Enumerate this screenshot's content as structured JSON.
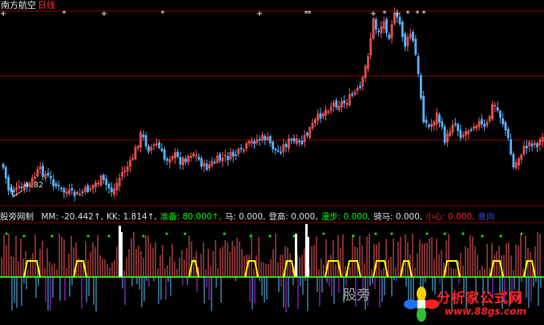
{
  "header": {
    "stock_name": "南方航空",
    "period": "日线"
  },
  "price_chart": {
    "low_label": "4.82",
    "colors": {
      "up": "#ff5a5a",
      "down": "#5ab4ff",
      "grid": "#8b0000",
      "marker": "#ffffff"
    }
  },
  "indicator": {
    "name": "股旁网制",
    "fields": [
      {
        "text": "MM: -20.442↑,",
        "color": "#e0e0e0"
      },
      {
        "text": "KK: 1.814↑,",
        "color": "#e0e0e0"
      },
      {
        "text": "准备: 80.000↑,",
        "color": "#00ff00"
      },
      {
        "text": "马: 0.000,",
        "color": "#e0e0e0"
      },
      {
        "text": "登高: 0.000,",
        "color": "#e0e0e0"
      },
      {
        "text": "漫步: 0.000,",
        "color": "#00ff00"
      },
      {
        "text": "骑马: 0.000,",
        "color": "#e0e0e0"
      },
      {
        "text": "小心: 0.000,",
        "color": "#ff2020"
      },
      {
        "text": "意向",
        "color": "#4040ff"
      }
    ]
  },
  "watermark": {
    "left_text": "股旁",
    "site_name": "分析家公式网",
    "url": "www.88gs.com"
  }
}
